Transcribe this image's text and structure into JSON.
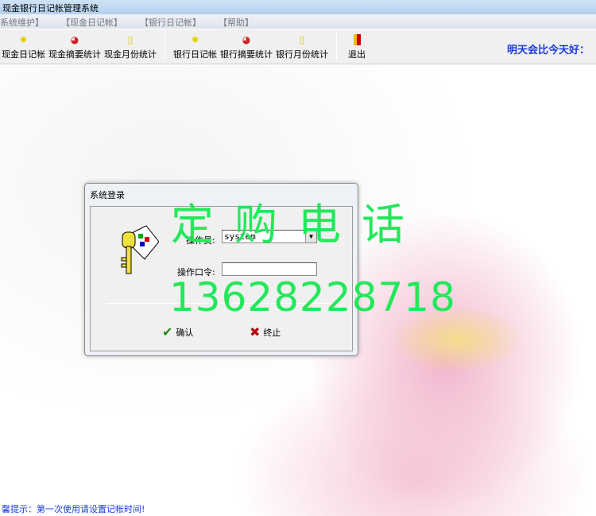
{
  "window": {
    "title": "现金银行日记帐管理系统"
  },
  "menu": [
    "系统维护】",
    "【现金日记帐】",
    "【银行日记帐】",
    "【帮助】"
  ],
  "toolbar": [
    {
      "label": "现金日记帐",
      "icon": "sun-icon"
    },
    {
      "label": "现金摘要统计",
      "icon": "pie-chart-icon"
    },
    {
      "label": "现金月份统计",
      "icon": "document-icon"
    },
    {
      "label": "银行日记帐",
      "icon": "sun-icon"
    },
    {
      "label": "银行摘要统计",
      "icon": "pie-chart-icon"
    },
    {
      "label": "银行月份统计",
      "icon": "document-icon"
    },
    {
      "label": "退出",
      "icon": "exit-door-icon"
    }
  ],
  "motto": "明天会比今天好：",
  "login": {
    "title": "系统登录",
    "operator_label": "操作员:",
    "operator_value": "system",
    "password_label": "操作口令:",
    "password_value": "",
    "ok": "确认",
    "cancel": "终止"
  },
  "watermark": {
    "line1": "定购电话",
    "line2": "13628228718"
  },
  "status": "馨提示：第一次使用请设置记帐时间!"
}
